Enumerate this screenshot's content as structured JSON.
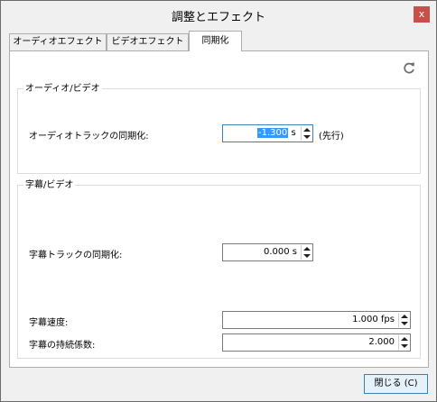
{
  "window": {
    "title": "調整とエフェクト",
    "close_glyph": "x"
  },
  "tabs": [
    {
      "label": "オーディオエフェクト",
      "active": false
    },
    {
      "label": "ビデオエフェクト",
      "active": false
    },
    {
      "label": "同期化",
      "active": true
    }
  ],
  "sync_panel": {
    "refresh_icon": "refresh-icon",
    "audio_video": {
      "title": "オーディオ/ビデオ",
      "audio_track_sync_label": "オーディオトラックの同期化:",
      "audio_track_sync_value": "-1.300",
      "audio_track_sync_unit": "s",
      "audio_track_sync_note": "(先行)"
    },
    "subtitles_video": {
      "title": "字幕/ビデオ",
      "subtitle_track_sync_label": "字幕トラックの同期化:",
      "subtitle_track_sync_value": "0.000 s",
      "subtitle_speed_label": "字幕速度:",
      "subtitle_speed_value": "1.000 fps",
      "subtitle_duration_factor_label": "字幕の持続係数:",
      "subtitle_duration_factor_value": "2.000"
    }
  },
  "footer": {
    "close_button_label": "閉じる (C)"
  },
  "colors": {
    "selection": "#3399ff",
    "close_button": "#c7504a",
    "focus_border": "#3c7fb1"
  }
}
